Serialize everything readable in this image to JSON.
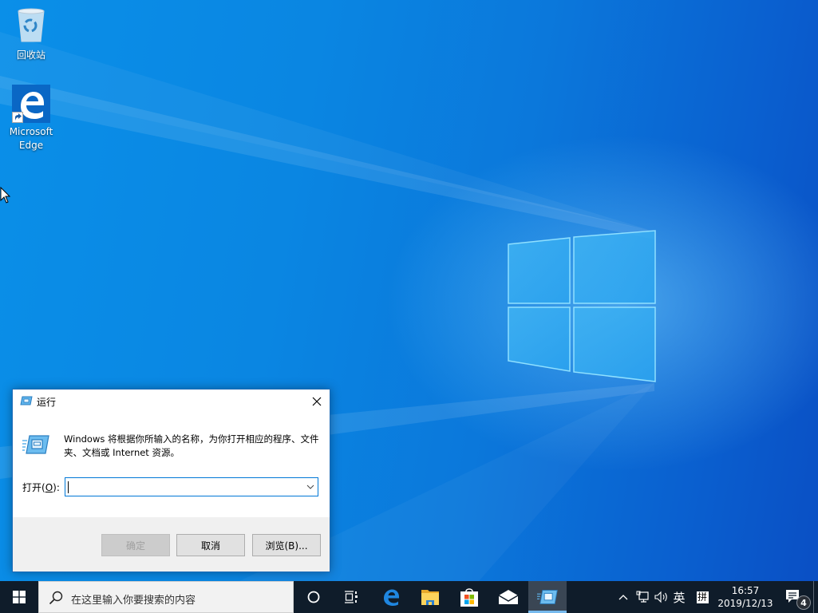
{
  "desktop": {
    "icons": [
      {
        "label": "回收站",
        "icon": "recycle-bin-icon"
      },
      {
        "label": "Microsoft Edge",
        "icon": "edge-icon",
        "shortcut": true
      }
    ]
  },
  "run_dialog": {
    "title": "运行",
    "description": "Windows 将根据你所输入的名称，为你打开相应的程序、文件夹、文档或 Internet 资源。",
    "open_label_prefix": "打开(",
    "open_label_accel": "O",
    "open_label_suffix": "):",
    "open_value": "",
    "buttons": {
      "ok": "确定",
      "cancel": "取消",
      "browse": "浏览(B)..."
    },
    "ok_disabled": true
  },
  "taskbar": {
    "search_placeholder": "在这里输入你要搜索的内容",
    "pinned": [
      "cortana-icon",
      "task-view-icon",
      "edge-icon",
      "file-explorer-icon",
      "store-icon",
      "mail-icon",
      "run-icon"
    ],
    "tray": {
      "ime_lang": "英",
      "ime_mode": "拼",
      "time": "16:57",
      "date": "2019/12/13",
      "notifications": "4"
    }
  }
}
